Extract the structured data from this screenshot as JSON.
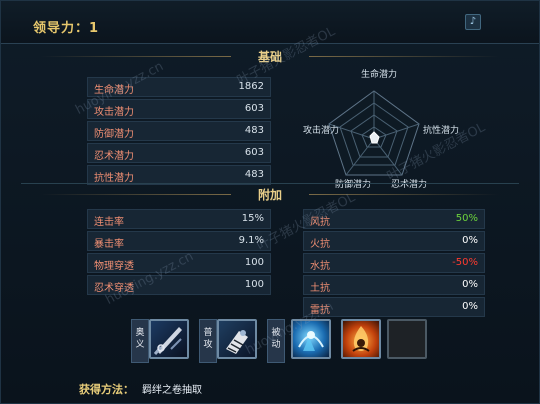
{
  "header": {
    "title": "领导力：1",
    "note_icon": "music-note-icon"
  },
  "sections": {
    "basic_title": "基础",
    "extra_title": "附加"
  },
  "basic_stats": [
    {
      "label": "生命潜力",
      "value": "1862"
    },
    {
      "label": "攻击潜力",
      "value": "603"
    },
    {
      "label": "防御潜力",
      "value": "483"
    },
    {
      "label": "忍术潜力",
      "value": "603"
    },
    {
      "label": "抗性潜力",
      "value": "483"
    }
  ],
  "radar": {
    "labels": [
      "生命潜力",
      "抗性潜力",
      "忍术潜力",
      "防御潜力",
      "攻击潜力"
    ]
  },
  "extra_left": [
    {
      "label": "连击率",
      "value": "15%"
    },
    {
      "label": "暴击率",
      "value": "9.1%"
    },
    {
      "label": "物理穿透",
      "value": "100"
    },
    {
      "label": "忍术穿透",
      "value": "100"
    }
  ],
  "extra_right": [
    {
      "label": "风抗",
      "value": "50%",
      "color": "#6cd33c"
    },
    {
      "label": "火抗",
      "value": "0%",
      "color": "#ffffff"
    },
    {
      "label": "水抗",
      "value": "-50%",
      "color": "#ff3b2f"
    },
    {
      "label": "土抗",
      "value": "0%",
      "color": "#ffffff"
    },
    {
      "label": "雷抗",
      "value": "0%",
      "color": "#ffffff"
    }
  ],
  "skills": {
    "tags": [
      "奥义",
      "普攻",
      "被动"
    ],
    "icons": [
      "blade-skill-icon",
      "palm-skill-icon",
      "chakra-skill-icon",
      "fire-skill-icon",
      "empty-skill-slot"
    ]
  },
  "obtain": {
    "label": "获得方法：",
    "method": "羁绊之卷抽取"
  },
  "watermarks": [
    "叶子猪火影忍者OL",
    "huoying.yzz.cn",
    "叶子猪火影忍者OL",
    "huoying.yzz.cn",
    "叶子猪火影忍者OL",
    "huoying.yzz.cn"
  ]
}
